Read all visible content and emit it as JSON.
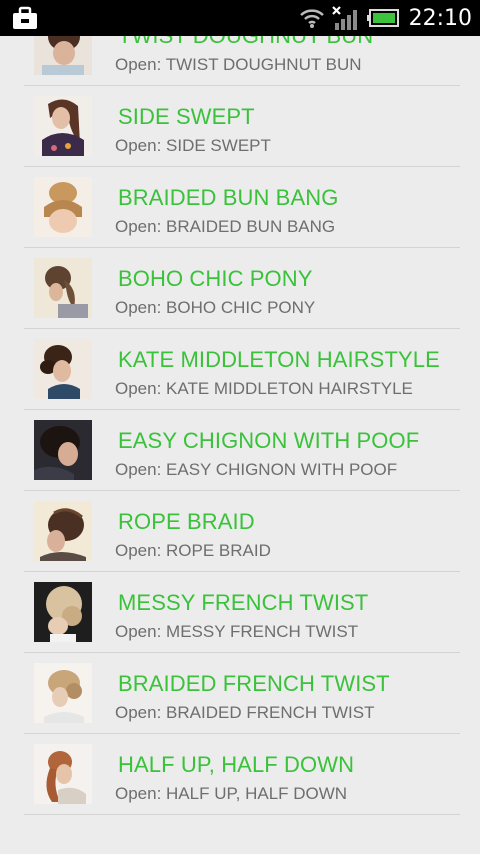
{
  "status_bar": {
    "time": "22:10",
    "icons": [
      "briefcase-icon",
      "wifi-icon",
      "signal-icon",
      "battery-icon"
    ]
  },
  "colors": {
    "title": "#39c23a",
    "subtitle": "#6e6e6e",
    "background": "#ececec",
    "divider": "#d4d4d4"
  },
  "items": [
    {
      "title": "TWIST DOUGHNUT BUN",
      "subtitle": "Open: TWIST DOUGHNUT BUN"
    },
    {
      "title": "SIDE SWEPT",
      "subtitle": "Open: SIDE SWEPT"
    },
    {
      "title": "BRAIDED BUN BANG",
      "subtitle": "Open: BRAIDED BUN BANG"
    },
    {
      "title": "BOHO CHIC PONY",
      "subtitle": "Open: BOHO CHIC PONY"
    },
    {
      "title": "KATE MIDDLETON HAIRSTYLE",
      "subtitle": "Open: KATE MIDDLETON HAIRSTYLE"
    },
    {
      "title": "EASY CHIGNON WITH POOF",
      "subtitle": "Open: EASY CHIGNON WITH POOF"
    },
    {
      "title": "ROPE BRAID",
      "subtitle": "Open: ROPE BRAID"
    },
    {
      "title": "MESSY FRENCH TWIST",
      "subtitle": "Open: MESSY FRENCH TWIST"
    },
    {
      "title": "BRAIDED FRENCH TWIST",
      "subtitle": "Open: BRAIDED FRENCH TWIST"
    },
    {
      "title": "HALF UP, HALF DOWN",
      "subtitle": "Open: HALF UP, HALF DOWN"
    }
  ]
}
